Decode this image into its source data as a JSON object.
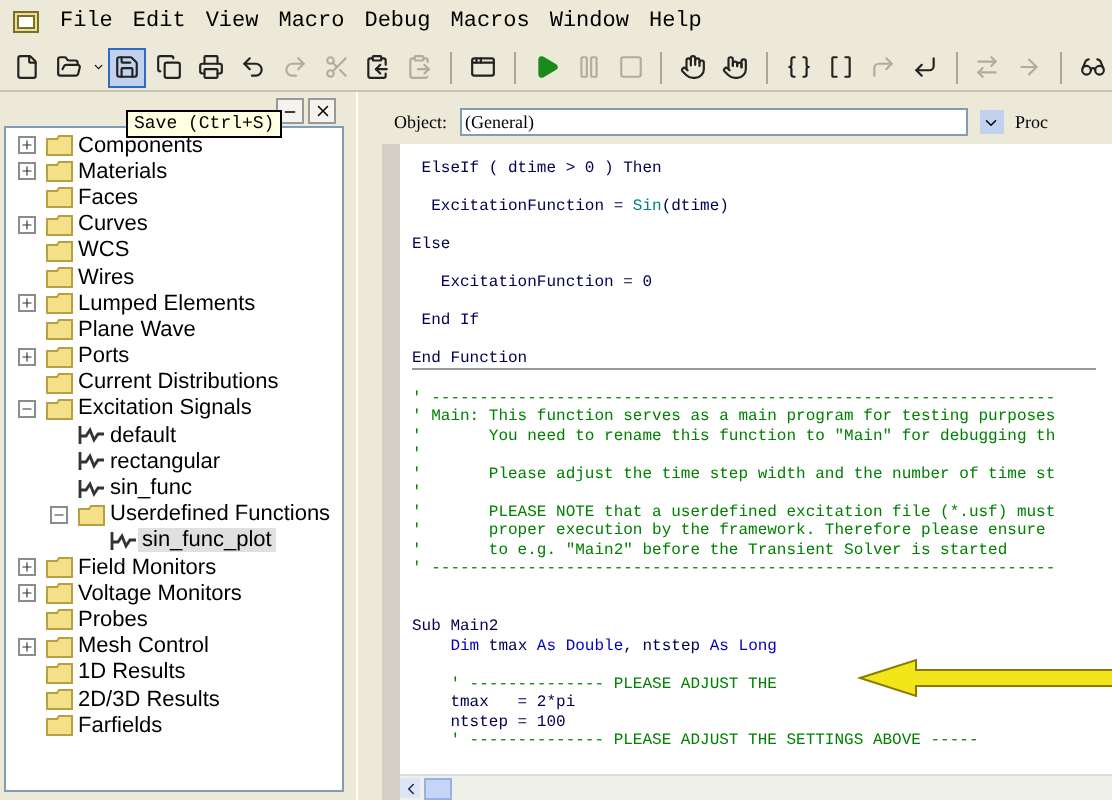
{
  "menu": [
    "File",
    "Edit",
    "View",
    "Macro",
    "Debug",
    "Macros",
    "Window",
    "Help"
  ],
  "toolbar": [
    {
      "disabled": false,
      "highlighted": false
    },
    {
      "disabled": false,
      "highlighted": false
    },
    {
      "disabled": false,
      "highlighted": true
    },
    {
      "disabled": false,
      "highlighted": false
    },
    {
      "disabled": false,
      "highlighted": false
    },
    {
      "disabled": false,
      "highlighted": false
    },
    {
      "disabled": true,
      "highlighted": false
    },
    {
      "disabled": true,
      "highlighted": false
    },
    {
      "disabled": false,
      "highlighted": false
    },
    {
      "disabled": true,
      "highlighted": false
    },
    {
      "disabled": false,
      "highlighted": false
    },
    {
      "disabled": false,
      "highlighted": false
    },
    {
      "disabled": true,
      "highlighted": false
    },
    {
      "disabled": true,
      "highlighted": false
    },
    {
      "disabled": false,
      "highlighted": false
    },
    {
      "disabled": false,
      "highlighted": false
    },
    {
      "disabled": false,
      "highlighted": false
    },
    {
      "disabled": false,
      "highlighted": false
    },
    {
      "disabled": true,
      "highlighted": false
    },
    {
      "disabled": false,
      "highlighted": false
    },
    {
      "disabled": true,
      "highlighted": false
    },
    {
      "disabled": true,
      "highlighted": false
    },
    {
      "disabled": false,
      "highlighted": false
    }
  ],
  "tooltip": "Save (Ctrl+S)",
  "tree": [
    {
      "label": "Components",
      "kind": "folder",
      "expanded": false,
      "selected": false
    },
    {
      "label": "Materials",
      "kind": "folder",
      "expanded": false,
      "selected": false
    },
    {
      "label": "Faces",
      "kind": "folder",
      "selected": false
    },
    {
      "label": "Curves",
      "kind": "folder",
      "expanded": false,
      "selected": false
    },
    {
      "label": "WCS",
      "kind": "folder",
      "selected": false
    },
    {
      "label": "Wires",
      "kind": "folder",
      "selected": false
    },
    {
      "label": "Lumped Elements",
      "kind": "folder",
      "expanded": false,
      "selected": false
    },
    {
      "label": "Plane Wave",
      "kind": "folder",
      "selected": false
    },
    {
      "label": "Ports",
      "kind": "folder",
      "expanded": false,
      "selected": false
    },
    {
      "label": "Current Distributions",
      "kind": "folder",
      "selected": false
    },
    {
      "label": "Excitation Signals",
      "kind": "folder",
      "expanded": true,
      "selected": false,
      "children": [
        {
          "label": "default",
          "kind": "signal",
          "selected": false
        },
        {
          "label": "rectangular",
          "kind": "signal",
          "selected": false
        },
        {
          "label": "sin_func",
          "kind": "signal",
          "selected": false
        },
        {
          "label": "Userdefined Functions",
          "kind": "folder",
          "expanded": true,
          "selected": false,
          "children": [
            {
              "label": "sin_func_plot",
              "kind": "signal",
              "selected": true
            }
          ]
        }
      ]
    },
    {
      "label": "Field Monitors",
      "kind": "folder",
      "expanded": false,
      "selected": false
    },
    {
      "label": "Voltage Monitors",
      "kind": "folder",
      "expanded": false,
      "selected": false
    },
    {
      "label": "Probes",
      "kind": "folder",
      "selected": false
    },
    {
      "label": "Mesh Control",
      "kind": "folder",
      "expanded": false,
      "selected": false
    },
    {
      "label": "1D Results",
      "kind": "folder",
      "selected": false
    },
    {
      "label": "2D/3D Results",
      "kind": "folder",
      "selected": false
    },
    {
      "label": "Farfields",
      "kind": "folder",
      "selected": false
    }
  ],
  "editor": {
    "object_label": "Object:",
    "object_value": "(General)",
    "proc_label": "Proc",
    "lines": [
      {
        "kind": "code",
        "tokens": [
          {
            "text": " ElseIf ( dtime > 0 ) Then",
            "kind": "code"
          }
        ]
      },
      {
        "kind": "blank"
      },
      {
        "kind": "code",
        "tokens": [
          {
            "text": "  ExcitationFunction = ",
            "kind": "code"
          },
          {
            "text": "Sin",
            "kind": "builtin"
          },
          {
            "text": "(dtime)",
            "kind": "code"
          }
        ]
      },
      {
        "kind": "blank"
      },
      {
        "kind": "code",
        "tokens": [
          {
            "text": "Else",
            "kind": "code"
          }
        ]
      },
      {
        "kind": "blank"
      },
      {
        "kind": "code",
        "tokens": [
          {
            "text": "   ExcitationFunction = 0",
            "kind": "code"
          }
        ]
      },
      {
        "kind": "blank"
      },
      {
        "kind": "code",
        "tokens": [
          {
            "text": " End If",
            "kind": "code"
          }
        ]
      },
      {
        "kind": "blank"
      },
      {
        "kind": "code",
        "tokens": [
          {
            "text": "End Function",
            "kind": "code"
          }
        ],
        "separator_after": true
      },
      {
        "kind": "blank"
      },
      {
        "kind": "code",
        "tokens": [
          {
            "text": "' -----------------------------------------------------------------",
            "kind": "comment"
          }
        ]
      },
      {
        "kind": "code",
        "tokens": [
          {
            "text": "' Main: This function serves as a main program for testing purposes",
            "kind": "comment"
          }
        ]
      },
      {
        "kind": "code",
        "tokens": [
          {
            "text": "'       You need to rename this function to \"Main\" for debugging th",
            "kind": "comment"
          }
        ]
      },
      {
        "kind": "code",
        "tokens": [
          {
            "text": "'",
            "kind": "comment"
          }
        ]
      },
      {
        "kind": "code",
        "tokens": [
          {
            "text": "'       Please adjust the time step width and the number of time st",
            "kind": "comment"
          }
        ]
      },
      {
        "kind": "code",
        "tokens": [
          {
            "text": "'",
            "kind": "comment"
          }
        ]
      },
      {
        "kind": "code",
        "tokens": [
          {
            "text": "'       PLEASE NOTE that a userdefined excitation file (*.usf) must",
            "kind": "comment"
          }
        ]
      },
      {
        "kind": "code",
        "tokens": [
          {
            "text": "'       proper execution by the framework. Therefore please ensure",
            "kind": "comment"
          }
        ]
      },
      {
        "kind": "code",
        "tokens": [
          {
            "text": "'       to e.g. \"Main2\" before the Transient Solver is started",
            "kind": "comment"
          }
        ]
      },
      {
        "kind": "code",
        "tokens": [
          {
            "text": "' -----------------------------------------------------------------",
            "kind": "comment"
          }
        ]
      },
      {
        "kind": "blank"
      },
      {
        "kind": "blank"
      },
      {
        "kind": "code",
        "tokens": [
          {
            "text": "Sub Main2",
            "kind": "code"
          }
        ]
      },
      {
        "kind": "code",
        "tokens": [
          {
            "text": "    Dim",
            "kind": "keyword"
          },
          {
            "text": " tmax ",
            "kind": "code"
          },
          {
            "text": "As Double",
            "kind": "keyword"
          },
          {
            "text": ", ntstep ",
            "kind": "code"
          },
          {
            "text": "As Long",
            "kind": "keyword"
          }
        ]
      },
      {
        "kind": "blank"
      },
      {
        "kind": "code",
        "tokens": [
          {
            "text": "    ' -------------- PLEASE ADJUST THE",
            "kind": "comment"
          }
        ]
      },
      {
        "kind": "code",
        "tokens": [
          {
            "text": "    tmax   = 2*pi",
            "kind": "code"
          }
        ]
      },
      {
        "kind": "code",
        "tokens": [
          {
            "text": "    ntstep = 100",
            "kind": "code"
          }
        ]
      },
      {
        "kind": "code",
        "tokens": [
          {
            "text": "    ' -------------- PLEASE ADJUST THE SETTINGS ABOVE -----",
            "kind": "comment"
          }
        ]
      }
    ]
  }
}
